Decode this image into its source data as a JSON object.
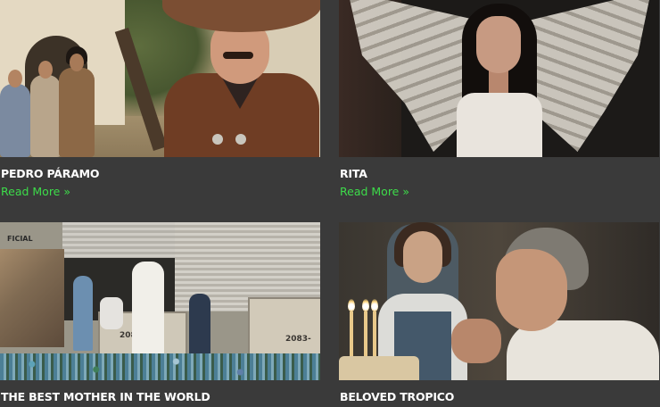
{
  "cards": [
    {
      "title": "PEDRO PÁRAMO",
      "more": "Read More »"
    },
    {
      "title": "RITA",
      "more": "Read More »"
    },
    {
      "title": "THE BEST MOTHER IN THE WORLD",
      "more": ""
    },
    {
      "title": "BELOVED TROPICO",
      "more": ""
    }
  ],
  "image_text": {
    "bin_label_1": "208",
    "bin_label_2": "2083-",
    "sign": "FICIAL"
  },
  "colors": {
    "background": "#3a3a3a",
    "title": "#ffffff",
    "link": "#3ddc4a"
  }
}
